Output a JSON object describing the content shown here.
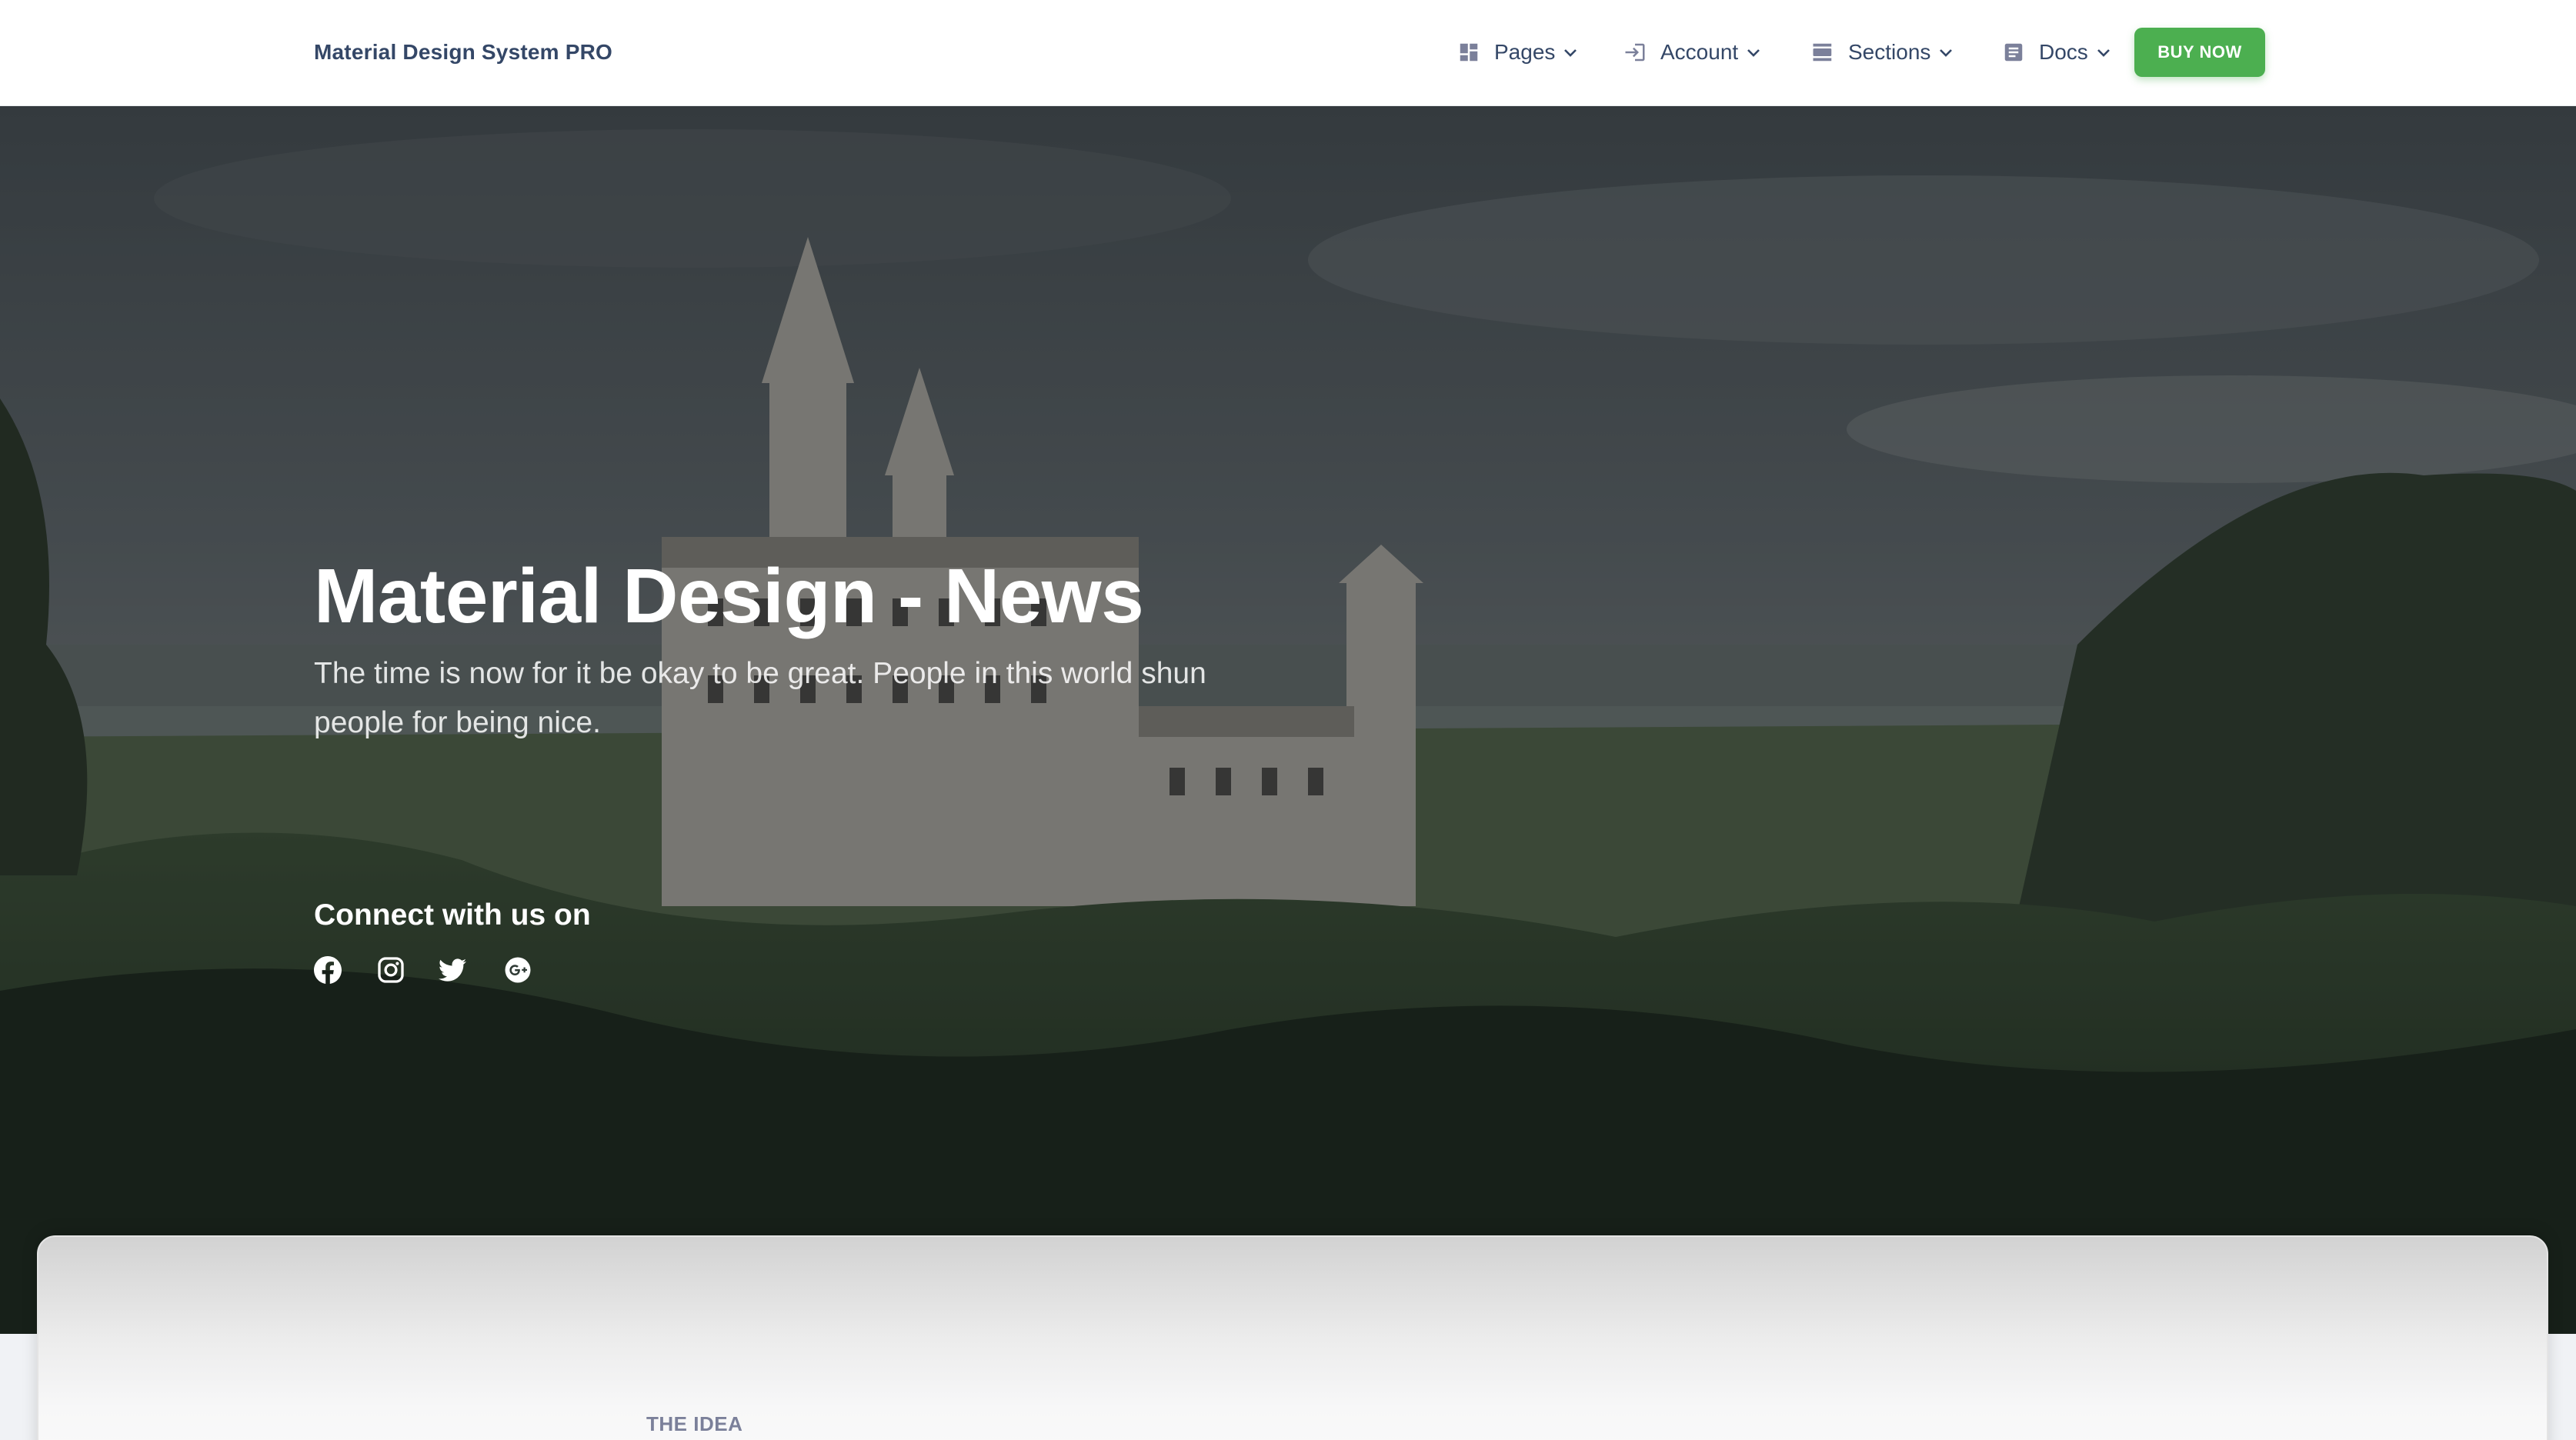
{
  "navbar": {
    "brand": "Material Design System PRO",
    "items": [
      {
        "label": "Pages",
        "icon": "dashboard-icon"
      },
      {
        "label": "Account",
        "icon": "login-icon"
      },
      {
        "label": "Sections",
        "icon": "view-day-icon"
      },
      {
        "label": "Docs",
        "icon": "article-icon"
      }
    ],
    "cta": "BUY NOW"
  },
  "hero": {
    "title": "Material Design - News",
    "subtitle": "The time is now for it be okay to be great. People in this world shun people for being nice.",
    "connect_label": "Connect with us on",
    "socials": [
      "facebook-icon",
      "instagram-icon",
      "twitter-icon",
      "google-plus-icon"
    ]
  },
  "section": {
    "eyebrow": "THE IDEA"
  },
  "colors": {
    "primary_text": "#344767",
    "buy_button": "#4caf50",
    "secondary_text": "#7b809a"
  }
}
